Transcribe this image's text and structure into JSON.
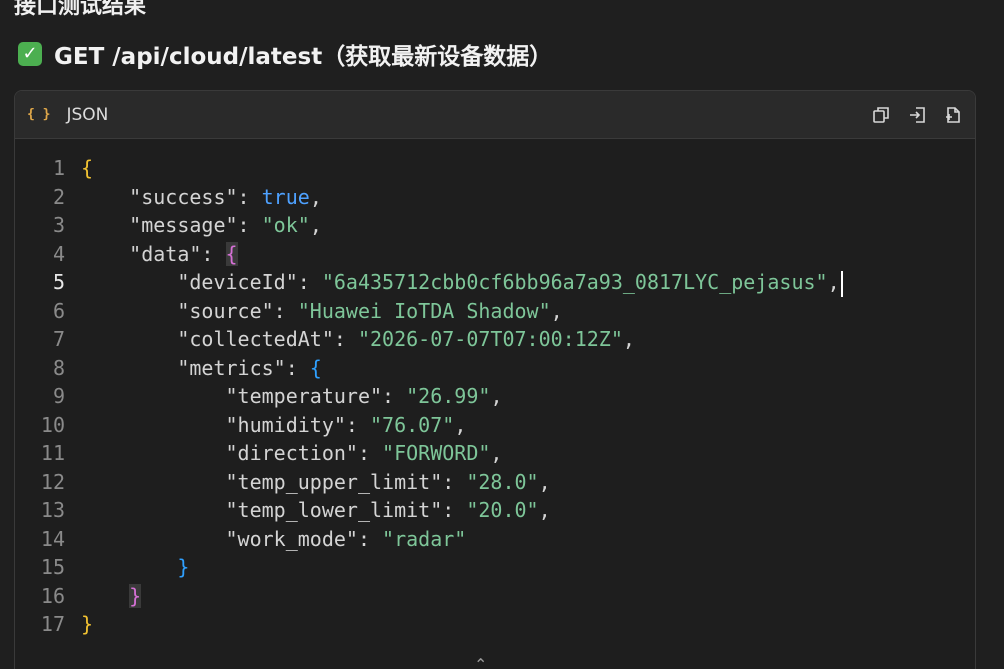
{
  "section": {
    "heading": "接口测试结果"
  },
  "endpoint": {
    "icon": "check-icon",
    "status_color": "#4caf50",
    "title": "GET /api/cloud/latest（获取最新设备数据）"
  },
  "code_block": {
    "language_icon": "braces-icon",
    "language_label": "JSON",
    "actions": [
      {
        "name": "copy-icon"
      },
      {
        "name": "export-icon"
      },
      {
        "name": "save-file-icon"
      }
    ],
    "active_line": 5,
    "lines": [
      {
        "n": "1"
      },
      {
        "n": "2"
      },
      {
        "n": "3"
      },
      {
        "n": "4"
      },
      {
        "n": "5"
      },
      {
        "n": "6"
      },
      {
        "n": "7"
      },
      {
        "n": "8"
      },
      {
        "n": "9"
      },
      {
        "n": "10"
      },
      {
        "n": "11"
      },
      {
        "n": "12"
      },
      {
        "n": "13"
      },
      {
        "n": "14"
      },
      {
        "n": "15"
      },
      {
        "n": "16"
      },
      {
        "n": "17"
      }
    ],
    "json": {
      "success_key": "\"success\"",
      "success_val": "true",
      "message_key": "\"message\"",
      "message_val": "\"ok\"",
      "data_key": "\"data\"",
      "deviceId_key": "\"deviceId\"",
      "deviceId_val": "\"6a435712cbb0cf6bb96a7a93_0817LYC_pejasus\"",
      "source_key": "\"source\"",
      "source_val": "\"Huawei IoTDA Shadow\"",
      "collectedAt_key": "\"collectedAt\"",
      "collectedAt_val": "\"2026-07-07T07:00:12Z\"",
      "metrics_key": "\"metrics\"",
      "temperature_key": "\"temperature\"",
      "temperature_val": "\"26.99\"",
      "humidity_key": "\"humidity\"",
      "humidity_val": "\"76.07\"",
      "direction_key": "\"direction\"",
      "direction_val": "\"FORWORD\"",
      "temp_upper_key": "\"temp_upper_limit\"",
      "temp_upper_val": "\"28.0\"",
      "temp_lower_key": "\"temp_lower_limit\"",
      "temp_lower_val": "\"20.0\"",
      "work_mode_key": "\"work_mode\"",
      "work_mode_val": "\"radar\""
    }
  },
  "footer": {
    "toggle_icon": "chevron-up-icon"
  }
}
